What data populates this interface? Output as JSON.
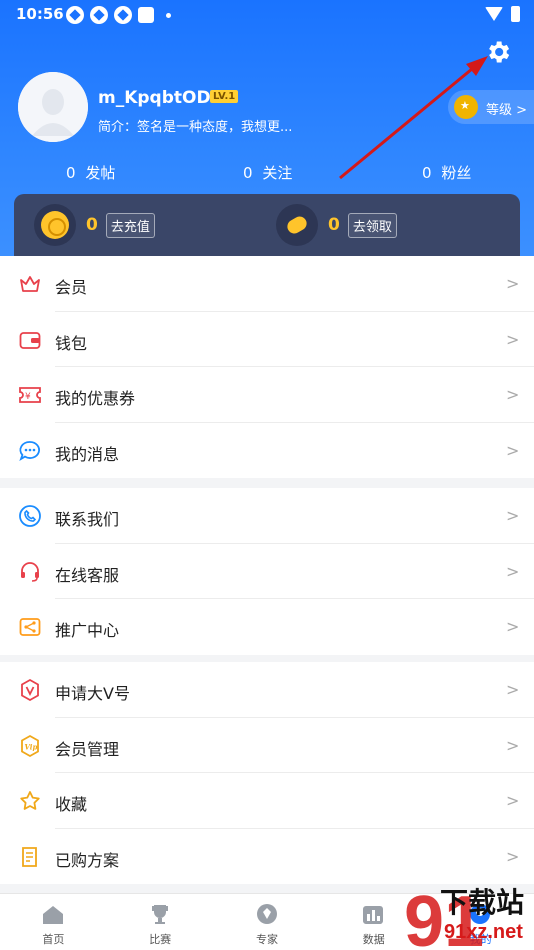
{
  "status": {
    "time": "10:56"
  },
  "profile": {
    "username": "m_KpqbtODe",
    "level_badge": "LV.1",
    "bio": "简介：签名是一种态度，我想更...",
    "level_label": "等级 >"
  },
  "stats": [
    {
      "count": "0",
      "label": "发帖"
    },
    {
      "count": "0",
      "label": "关注"
    },
    {
      "count": "0",
      "label": "粉丝"
    }
  ],
  "wallet": {
    "coins": {
      "value": "0",
      "action": "去充值"
    },
    "beans": {
      "value": "0",
      "action": "去领取"
    }
  },
  "menu_groups": [
    [
      {
        "label": "会员",
        "icon": "crown-icon",
        "color": "#e8414b"
      },
      {
        "label": "钱包",
        "icon": "wallet-icon",
        "color": "#e8414b"
      },
      {
        "label": "我的优惠券",
        "icon": "coupon-icon",
        "color": "#e8414b"
      },
      {
        "label": "我的消息",
        "icon": "message-icon",
        "color": "#1a8cff"
      }
    ],
    [
      {
        "label": "联系我们",
        "icon": "phone-icon",
        "color": "#1a8cff"
      },
      {
        "label": "在线客服",
        "icon": "headset-icon",
        "color": "#e8414b"
      },
      {
        "label": "推广中心",
        "icon": "share-icon",
        "color": "#ff9c1a"
      }
    ],
    [
      {
        "label": "申请大V号",
        "icon": "v-badge-icon",
        "color": "#e8414b"
      },
      {
        "label": "会员管理",
        "icon": "vip-icon",
        "color": "#f0a81a"
      },
      {
        "label": "收藏",
        "icon": "star-icon",
        "color": "#f0a81a"
      },
      {
        "label": "已购方案",
        "icon": "receipt-icon",
        "color": "#f0a81a"
      }
    ]
  ],
  "chevron": ">",
  "tabs": [
    {
      "label": "首页",
      "icon": "home-icon"
    },
    {
      "label": "比赛",
      "icon": "trophy-icon"
    },
    {
      "label": "专家",
      "icon": "expert-icon"
    },
    {
      "label": "数据",
      "icon": "data-icon"
    },
    {
      "label": "我的",
      "icon": "profile-icon"
    }
  ],
  "watermark": {
    "line1": "下载站",
    "line2": "91xz.net",
    "number": "91"
  },
  "colors": {
    "header": "#1a73ff",
    "wallet_bg": "#3a4668",
    "gold": "#ffc42b",
    "accent_red": "#e02020"
  }
}
